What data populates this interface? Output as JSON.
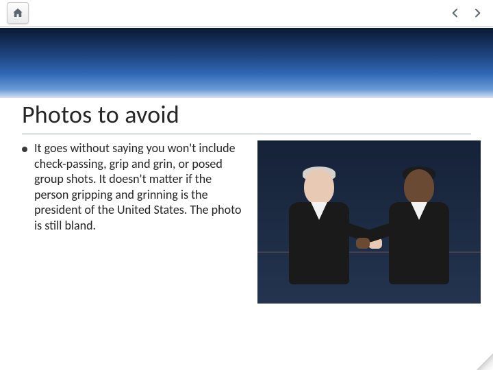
{
  "slide": {
    "title": "Photos to avoid",
    "bullets": [
      "It goes without saying you won't include check-passing, grip and grin, or posed group shots. It doesn't matter if the person gripping and grinning is the president of the United States. The photo is still bland."
    ],
    "image_alt": "Two politicians in suits shaking hands on a debate stage"
  },
  "nav": {
    "home_label": "Home",
    "prev_label": "Previous",
    "next_label": "Next"
  }
}
